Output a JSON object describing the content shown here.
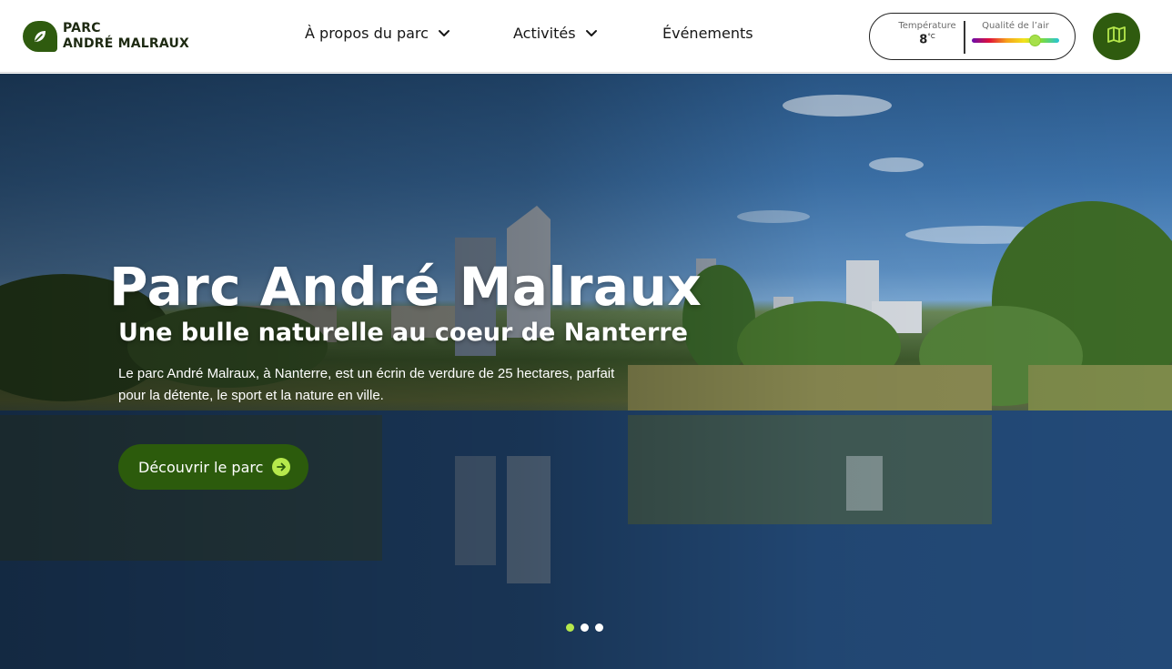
{
  "logo": {
    "line1": "PARC",
    "line2": "ANDRÉ MALRAUX",
    "icon": "leaf-icon"
  },
  "nav": {
    "items": [
      {
        "label": "À propos du parc",
        "has_dropdown": true
      },
      {
        "label": "Activités",
        "has_dropdown": true
      },
      {
        "label": "Événements",
        "has_dropdown": false
      }
    ]
  },
  "weather": {
    "temperature_label": "Température",
    "temperature_value": "8",
    "temperature_unit": "°C",
    "air_quality_label": "Qualité de l’air",
    "air_quality_level": 0.72
  },
  "map_button": {
    "icon": "map-icon"
  },
  "hero": {
    "title": "Parc André Malraux",
    "subtitle": "Une bulle naturelle au coeur de Nanterre",
    "description": "Le parc André Malraux, à Nanterre, est un écrin de verdure de 25 hectares, parfait pour la détente, le sport et la nature en ville.",
    "cta_label": "Découvrir le parc",
    "cta_icon": "arrow-right-circle-icon",
    "slides_count": 3,
    "active_slide": 1
  },
  "colors": {
    "brand_green": "#2f5b0f",
    "accent_lime": "#b6e84c"
  }
}
